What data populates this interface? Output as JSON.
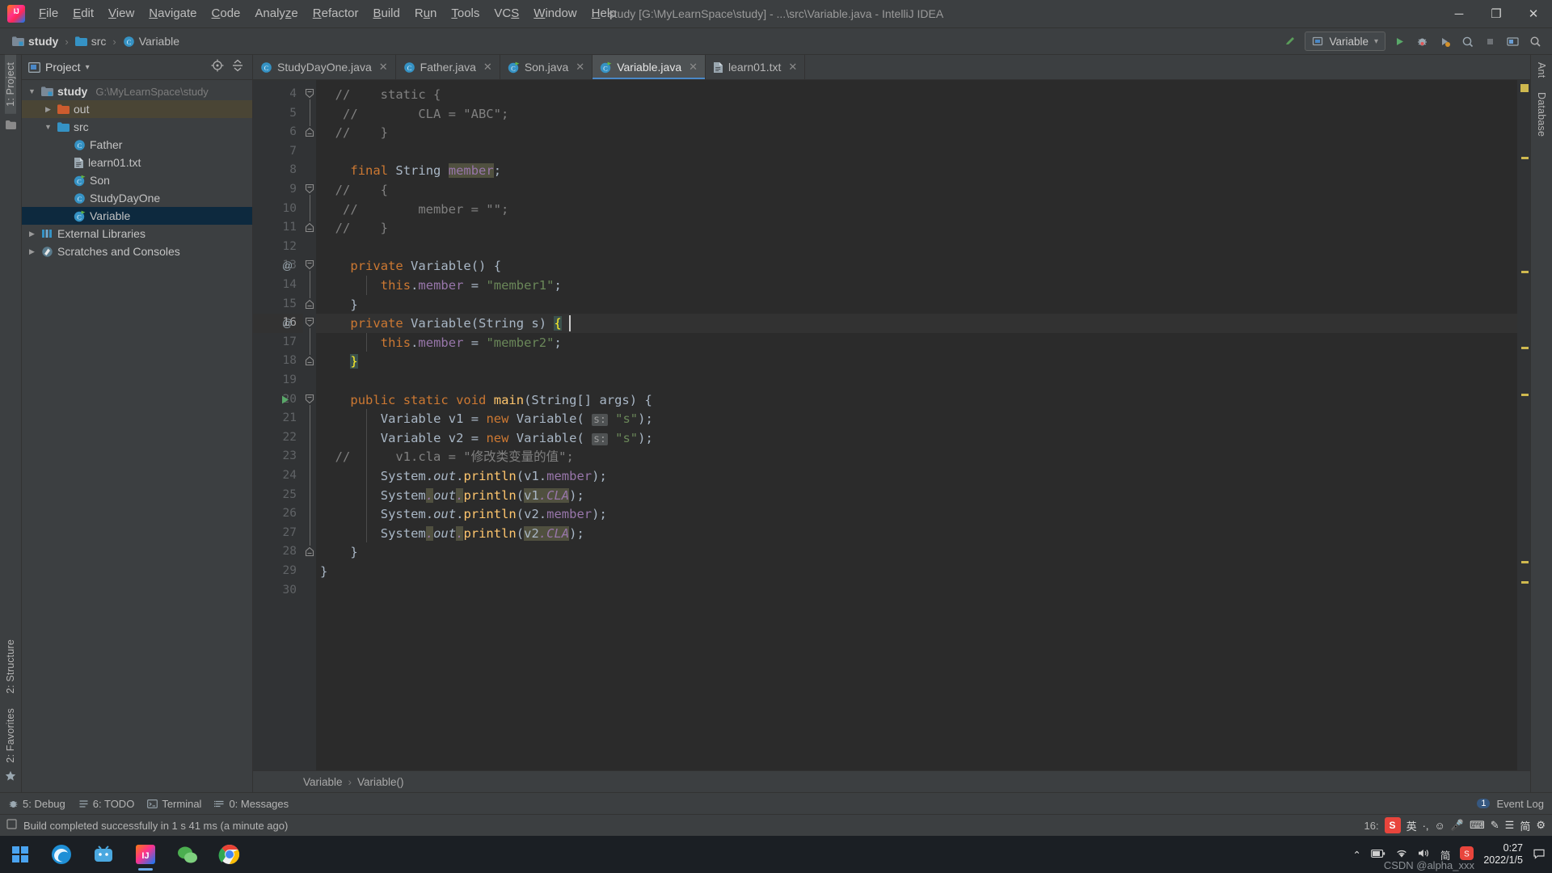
{
  "window": {
    "title": "study [G:\\MyLearnSpace\\study] - ...\\src\\Variable.java - IntelliJ IDEA",
    "logo_alt": "intellij-idea-logo",
    "minimize": "─",
    "maximize": "❐",
    "close": "✕"
  },
  "menu": [
    {
      "label": "File",
      "mnemonic": "F"
    },
    {
      "label": "Edit",
      "mnemonic": "E"
    },
    {
      "label": "View",
      "mnemonic": "V"
    },
    {
      "label": "Navigate",
      "mnemonic": "N"
    },
    {
      "label": "Code",
      "mnemonic": "C"
    },
    {
      "label": "Analyze",
      "mnemonic": "z"
    },
    {
      "label": "Refactor",
      "mnemonic": "R"
    },
    {
      "label": "Build",
      "mnemonic": "B"
    },
    {
      "label": "Run",
      "mnemonic": "u"
    },
    {
      "label": "Tools",
      "mnemonic": "T"
    },
    {
      "label": "VCS",
      "mnemonic": "S"
    },
    {
      "label": "Window",
      "mnemonic": "W"
    },
    {
      "label": "Help",
      "mnemonic": "H"
    }
  ],
  "navbar": {
    "breadcrumbs": [
      {
        "label": "study",
        "icon": "module-icon"
      },
      {
        "label": "src",
        "icon": "source-folder-icon"
      },
      {
        "label": "Variable",
        "icon": "java-class-icon"
      }
    ],
    "separator": "›",
    "run_config": "Variable",
    "dropdown_caret": "▾"
  },
  "left_strip": [
    {
      "label": "1: Project",
      "active": true
    }
  ],
  "left_strip_bottom": [
    {
      "label": "2: Structure",
      "active": false
    },
    {
      "label": "2: Favorites",
      "active": false
    }
  ],
  "right_strip": [
    {
      "label": "Ant",
      "active": false
    },
    {
      "label": "Database",
      "active": false
    }
  ],
  "project_panel": {
    "title": "Project",
    "caret": "▾",
    "tree": [
      {
        "indent": 0,
        "arrow": "▼",
        "icon": "module-icon",
        "label": "study",
        "bold": true,
        "path": "G:\\MyLearnSpace\\study",
        "state": "normal"
      },
      {
        "indent": 1,
        "arrow": "▶",
        "icon": "excluded-folder-icon",
        "label": "out",
        "bold": false,
        "path": "",
        "state": "highlighted"
      },
      {
        "indent": 1,
        "arrow": "▼",
        "icon": "source-folder-icon",
        "label": "src",
        "bold": false,
        "path": "",
        "state": "normal"
      },
      {
        "indent": 2,
        "arrow": "",
        "icon": "java-class-icon",
        "label": "Father",
        "bold": false,
        "path": "",
        "state": "normal"
      },
      {
        "indent": 2,
        "arrow": "",
        "icon": "text-file-icon",
        "label": "learn01.txt",
        "bold": false,
        "path": "",
        "state": "normal"
      },
      {
        "indent": 2,
        "arrow": "",
        "icon": "java-class-runnable-icon",
        "label": "Son",
        "bold": false,
        "path": "",
        "state": "normal"
      },
      {
        "indent": 2,
        "arrow": "",
        "icon": "java-class-icon",
        "label": "StudyDayOne",
        "bold": false,
        "path": "",
        "state": "normal"
      },
      {
        "indent": 2,
        "arrow": "",
        "icon": "java-class-runnable-icon",
        "label": "Variable",
        "bold": false,
        "path": "",
        "state": "selected"
      },
      {
        "indent": 0,
        "arrow": "▶",
        "icon": "libraries-icon",
        "label": "External Libraries",
        "bold": false,
        "path": "",
        "state": "normal"
      },
      {
        "indent": 0,
        "arrow": "▶",
        "icon": "scratches-icon",
        "label": "Scratches and Consoles",
        "bold": false,
        "path": "",
        "state": "normal"
      }
    ]
  },
  "editor_tabs": [
    {
      "label": "StudyDayOne.java",
      "icon": "java-class-icon",
      "active": false,
      "close": "✕"
    },
    {
      "label": "Father.java",
      "icon": "java-class-icon",
      "active": false,
      "close": "✕"
    },
    {
      "label": "Son.java",
      "icon": "java-class-runnable-icon",
      "active": false,
      "close": "✕"
    },
    {
      "label": "Variable.java",
      "icon": "java-class-runnable-icon",
      "active": true,
      "close": "✕"
    },
    {
      "label": "learn01.txt",
      "icon": "text-file-icon",
      "active": false,
      "close": "✕"
    }
  ],
  "editor": {
    "first_visible_line": 4,
    "last_visible_line": 30,
    "caret_line": 16,
    "lines": [
      {
        "n": 4,
        "gutter": "",
        "fold": "fold-start",
        "text": "  //    static {"
      },
      {
        "n": 5,
        "gutter": "",
        "fold": "",
        "text": "   //        CLA = \"ABC\";"
      },
      {
        "n": 6,
        "gutter": "",
        "fold": "fold-end",
        "text": "  //    }"
      },
      {
        "n": 7,
        "gutter": "",
        "fold": "",
        "text": ""
      },
      {
        "n": 8,
        "gutter": "",
        "fold": "",
        "text": "    final String member;"
      },
      {
        "n": 9,
        "gutter": "",
        "fold": "fold-start",
        "text": "  //    {"
      },
      {
        "n": 10,
        "gutter": "",
        "fold": "",
        "text": "   //        member = \"\";"
      },
      {
        "n": 11,
        "gutter": "",
        "fold": "fold-end",
        "text": "  //    }"
      },
      {
        "n": 12,
        "gutter": "",
        "fold": "",
        "text": ""
      },
      {
        "n": 13,
        "gutter": "override-marker",
        "fold": "fold-start",
        "text": "    private Variable() {"
      },
      {
        "n": 14,
        "gutter": "",
        "fold": "",
        "text": "        this.member = \"member1\";"
      },
      {
        "n": 15,
        "gutter": "",
        "fold": "fold-end",
        "text": "    }"
      },
      {
        "n": 16,
        "gutter": "override-marker",
        "fold": "fold-start",
        "text": "    private Variable(String s) {"
      },
      {
        "n": 17,
        "gutter": "",
        "fold": "",
        "text": "        this.member = \"member2\";"
      },
      {
        "n": 18,
        "gutter": "",
        "fold": "fold-end",
        "text": "    }"
      },
      {
        "n": 19,
        "gutter": "",
        "fold": "",
        "text": ""
      },
      {
        "n": 20,
        "gutter": "run-marker",
        "fold": "fold-start",
        "text": "    public static void main(String[] args) {"
      },
      {
        "n": 21,
        "gutter": "",
        "fold": "",
        "text": "        Variable v1 = new Variable( s: \"s\");"
      },
      {
        "n": 22,
        "gutter": "",
        "fold": "",
        "text": "        Variable v2 = new Variable( s: \"s\");"
      },
      {
        "n": 23,
        "gutter": "",
        "fold": "",
        "text": "  //      v1.cla = \"修改类变量的值\";"
      },
      {
        "n": 24,
        "gutter": "",
        "fold": "",
        "text": "        System.out.println(v1.member);"
      },
      {
        "n": 25,
        "gutter": "",
        "fold": "",
        "text": "        System.out.println(v1.CLA);"
      },
      {
        "n": 26,
        "gutter": "",
        "fold": "",
        "text": "        System.out.println(v2.member);"
      },
      {
        "n": 27,
        "gutter": "",
        "fold": "",
        "text": "        System.out.println(v2.CLA);"
      },
      {
        "n": 28,
        "gutter": "",
        "fold": "fold-end",
        "text": "    }"
      },
      {
        "n": 29,
        "gutter": "",
        "fold": "",
        "text": "}"
      },
      {
        "n": 30,
        "gutter": "",
        "fold": "",
        "text": ""
      }
    ],
    "param_hint": "s:"
  },
  "editor_breadcrumb": {
    "items": [
      "Variable",
      "Variable()"
    ],
    "separator": "›"
  },
  "bottom_tool_window": [
    {
      "label": "5: Debug",
      "icon": "debug-icon"
    },
    {
      "label": "6: TODO",
      "icon": "todo-icon"
    },
    {
      "label": "Terminal",
      "icon": "terminal-icon"
    },
    {
      "label": "0: Messages",
      "icon": "messages-icon"
    }
  ],
  "event_log": {
    "label": "Event Log",
    "count": "1"
  },
  "status_bar": {
    "message": "Build completed successfully in 1 s 41 ms (a minute ago)",
    "icon": "build-icon",
    "caret_position": "16:",
    "ime_lang": "英",
    "ime_items": [
      "英",
      "·,",
      "☺",
      "🎤",
      "⌨",
      "✎",
      "☰",
      "简",
      "⚙"
    ],
    "sogou_badge": "S"
  },
  "taskbar": {
    "apps": [
      {
        "name": "start-button",
        "icon": "windows-logo-icon",
        "running": false
      },
      {
        "name": "edge",
        "icon": "edge-icon",
        "running": false
      },
      {
        "name": "bilibili",
        "icon": "bilibili-icon",
        "running": false
      },
      {
        "name": "intellij-idea",
        "icon": "intellij-idea-icon",
        "running": true
      },
      {
        "name": "wechat",
        "icon": "wechat-icon",
        "running": false
      },
      {
        "name": "chrome",
        "icon": "chrome-icon",
        "running": false
      }
    ],
    "tray": {
      "chevron": "⌃",
      "items": [
        "battery-icon",
        "wifi-icon",
        "volume-icon",
        "ime-icon",
        "sogou-icon"
      ],
      "time": "0:27",
      "date": "2022/1/5",
      "notification": "notification-icon"
    },
    "watermark": "CSDN @alpha_xxx"
  }
}
